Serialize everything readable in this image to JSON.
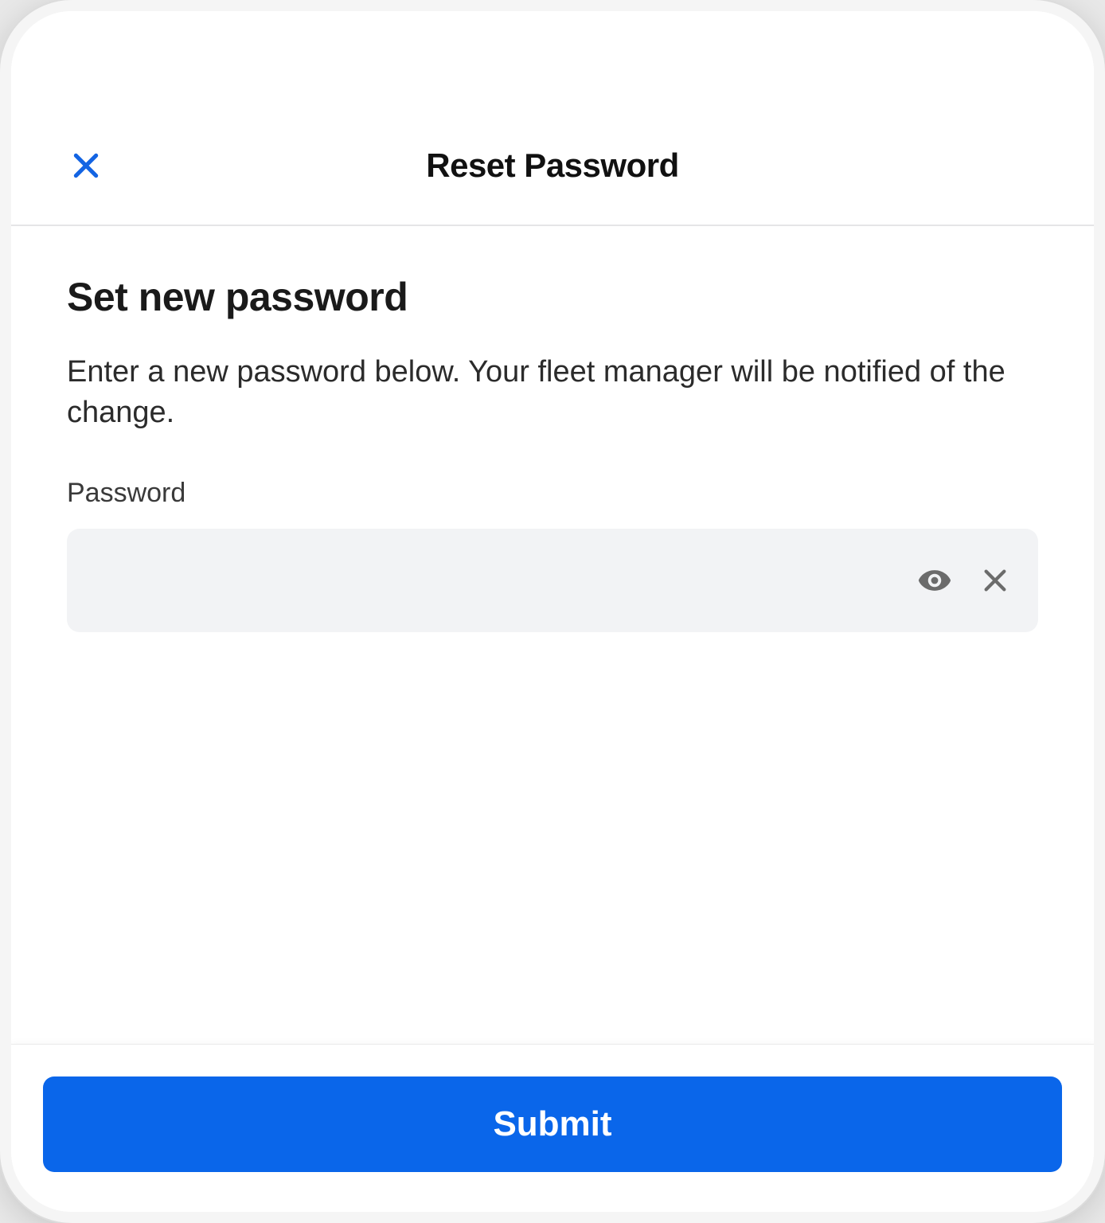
{
  "nav": {
    "title": "Reset Password",
    "close_icon": "close"
  },
  "content": {
    "heading": "Set new password",
    "description": "Enter a new password below. Your fleet manager will be notified of the change.",
    "password_label": "Password",
    "password_value": ""
  },
  "icons": {
    "toggle_visibility": "eye",
    "clear": "clear-x"
  },
  "footer": {
    "submit_label": "Submit"
  },
  "colors": {
    "accent_blue": "#0a66ea",
    "close_blue": "#1364e3",
    "input_bg": "#f2f3f5",
    "text_primary": "#1a1a1a",
    "text_body": "#2b2b2b",
    "icon_gray": "#6b6b6b"
  }
}
